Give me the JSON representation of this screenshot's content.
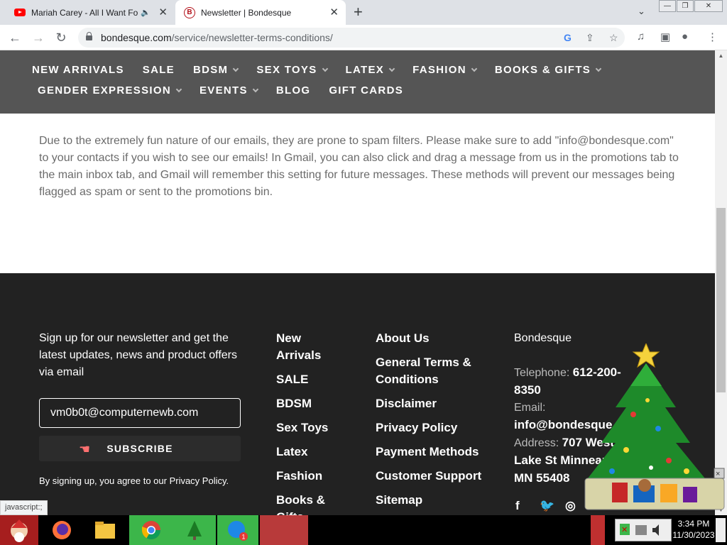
{
  "tabs": [
    {
      "title": "Mariah Carey - All I Want For Christmas Is You",
      "icon": "youtube-icon",
      "audio": "🔈"
    },
    {
      "title": "Newsletter | Bondesque",
      "icon": "bondesque-icon"
    }
  ],
  "toolbar": {
    "url_domain": "bondesque.com",
    "url_path": "/service/newsletter-terms-conditions/"
  },
  "nav": {
    "row1": [
      {
        "label": "NEW ARRIVALS",
        "dropdown": false
      },
      {
        "label": "SALE",
        "dropdown": false
      },
      {
        "label": "BDSM",
        "dropdown": true
      },
      {
        "label": "SEX TOYS",
        "dropdown": true
      },
      {
        "label": "LATEX",
        "dropdown": true
      },
      {
        "label": "FASHION",
        "dropdown": true
      },
      {
        "label": "BOOKS & GIFTS",
        "dropdown": true
      }
    ],
    "row2": [
      {
        "label": "GENDER EXPRESSION",
        "dropdown": true
      },
      {
        "label": "EVENTS",
        "dropdown": true
      },
      {
        "label": "BLOG",
        "dropdown": false
      },
      {
        "label": "GIFT CARDS",
        "dropdown": false
      }
    ]
  },
  "content": {
    "paragraph": "Due to the extremely fun nature of our emails, they are prone to spam filters. Please make sure to add \"info@bondesque.com\" to your contacts if you wish to see our emails! In Gmail, you can also click and drag a message from us in the promotions tab to the main inbox tab, and Gmail will remember this setting for future messages. These methods will prevent our messages being flagged as spam or sent to the promotions bin."
  },
  "footer": {
    "newsletter_text": "Sign up for our newsletter and get the latest updates, news and product offers via email",
    "email_value": "vm0b0t@computernewb.com",
    "subscribe_label": "SUBSCRIBE",
    "agree_prefix": "By signing up, you agree to our ",
    "agree_link": "Privacy Policy",
    "agree_suffix": ".",
    "col1": [
      "New Arrivals",
      "SALE",
      "BDSM",
      "Sex Toys",
      "Latex",
      "Fashion",
      "Books & Gifts"
    ],
    "col2": [
      "About Us",
      "General Terms & Conditions",
      "Disclaimer",
      "Privacy Policy",
      "Payment Methods",
      "Customer Support",
      "Sitemap"
    ],
    "company": "Bondesque",
    "telephone_label": "Telephone: ",
    "telephone": "612-200-8350",
    "email_label": "Email:",
    "email": "info@bondesque.com",
    "address_label": "Address: ",
    "address": "707 West Lake St Minneapolis, MN 55408",
    "social": [
      "facebook-icon",
      "twitter-icon",
      "instagram-icon"
    ]
  },
  "status_text": "javascript:;",
  "clock": {
    "time": "3:34 PM",
    "date": "11/30/2023"
  },
  "taskbar_badge": "1"
}
